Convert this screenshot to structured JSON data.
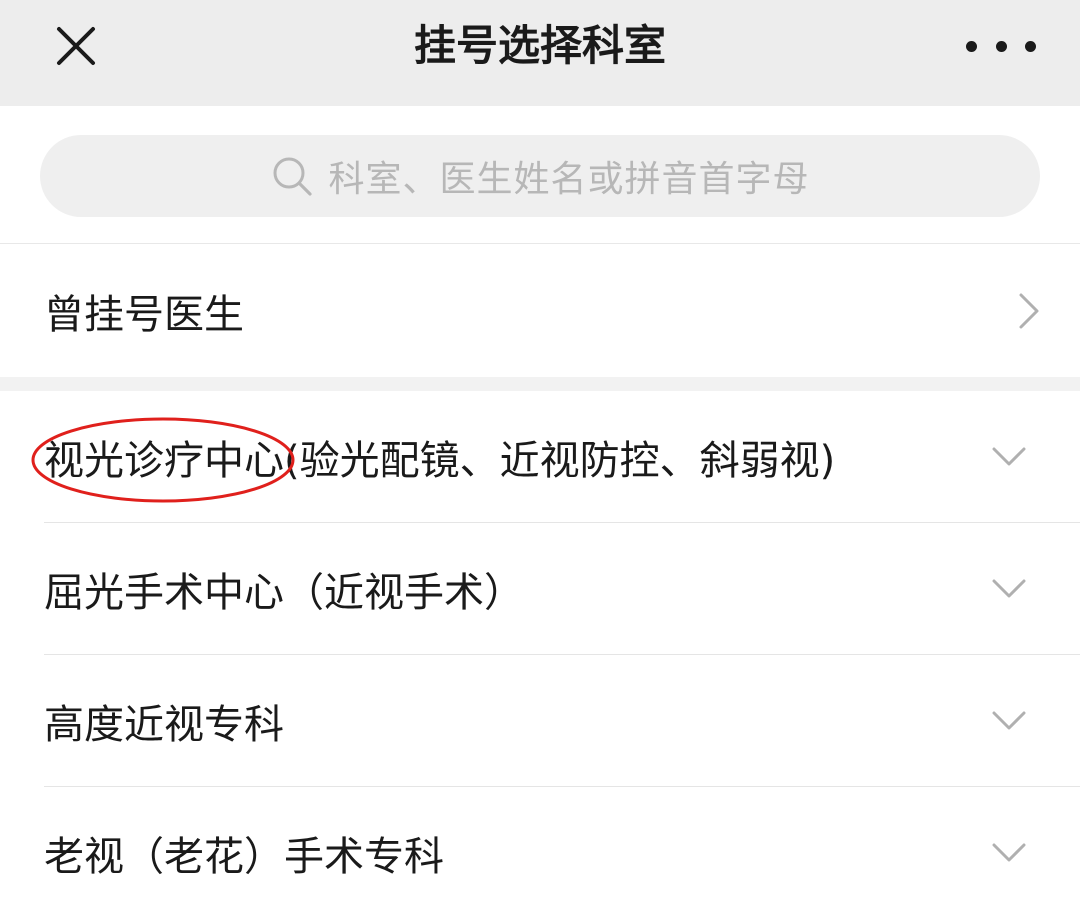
{
  "header": {
    "title": "挂号选择科室",
    "close_icon": "close-icon",
    "more_icon": "more-dots-icon"
  },
  "search": {
    "placeholder": "科室、医生姓名或拼音首字母",
    "icon": "search-icon"
  },
  "history": {
    "label": "曾挂号医生",
    "icon": "chevron-right-icon"
  },
  "departments": [
    {
      "label": "视光诊疗中心(验光配镜、近视防控、斜弱视)",
      "icon": "chevron-down-icon"
    },
    {
      "label": "屈光手术中心（近视手术）",
      "icon": "chevron-down-icon"
    },
    {
      "label": "高度近视专科",
      "icon": "chevron-down-icon"
    },
    {
      "label": "老视（老花）手术专科",
      "icon": "chevron-down-icon"
    }
  ],
  "colors": {
    "header_bg": "#ededed",
    "search_bg": "#efefef",
    "placeholder": "#b7b7b7",
    "annotation": "#e0201c"
  }
}
